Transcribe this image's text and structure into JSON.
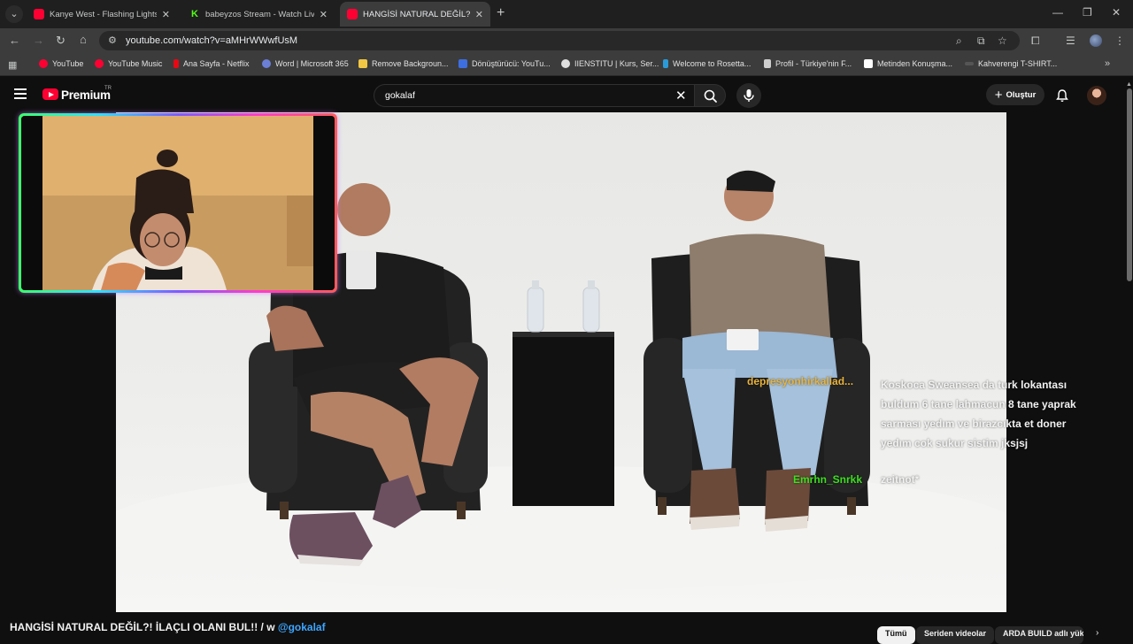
{
  "browser": {
    "tabs": [
      {
        "title": "Kanye West - Flashing Lights ft",
        "icon": "youtube-icon",
        "active": false
      },
      {
        "title": "babeyzos Stream - Watch Live",
        "icon": "kick-icon",
        "active": false
      },
      {
        "title": "HANGİSİ NATURAL DEĞİL?! İLAÇ",
        "icon": "youtube-icon",
        "active": true
      }
    ],
    "tab_close_glyph": "✕",
    "new_tab_glyph": "+",
    "tab_menu_glyph": "⌄",
    "kick_letter": "K",
    "window_controls": {
      "minimize": "—",
      "restore": "❐",
      "close": "✕"
    },
    "url": "youtube.com/watch?v=aMHrWWwfUsM",
    "bookmarks": [
      {
        "label": "YouTube",
        "color": "#ff0033"
      },
      {
        "label": "YouTube Music",
        "color": "#ff0033"
      },
      {
        "label": "Ana Sayfa - Netflix",
        "color": "#e50914"
      },
      {
        "label": "Word | Microsoft 365",
        "color": "#6b7fd6"
      },
      {
        "label": "Remove Backgroun...",
        "color": "#f2c744"
      },
      {
        "label": "Dönüştürücü: YouTu...",
        "color": "#3d6fe0"
      },
      {
        "label": "IIENSTITU | Kurs, Ser...",
        "color": "#e0e0e0"
      },
      {
        "label": "Welcome to Rosetta...",
        "color": "#2a9bd8"
      },
      {
        "label": "Profil - Türkiye'nin F...",
        "color": "#cfcfcf"
      },
      {
        "label": "Metinden Konuşma...",
        "color": "#ffffff"
      },
      {
        "label": "Kahverengi T-SHIRT...",
        "color": "#555555"
      }
    ]
  },
  "youtube": {
    "brand": "Premium",
    "region": "TR",
    "search_query": "gokalaf",
    "create_label": "Oluştur"
  },
  "chat": [
    {
      "user": "depresyonhirkaliad...",
      "message": "Koskoca Sweansea da turk lokantası buldum 6 tane lahmacun 8 tane yaprak sarması yedım ve birazcıkta et doner yedım cok sukur sistim jksjsj",
      "user_color": "#e8b33c"
    },
    {
      "user": "Emrhn_Snrkk",
      "message": "zeitnot*",
      "user_color": "#3ce01e"
    }
  ],
  "video": {
    "title_main": "HANGİSİ NATURAL DEĞİL?! İLAÇLI OLANI BUL!! / w",
    "title_mention": "@gokalaf"
  },
  "chips": [
    "Tümü",
    "Seriden videolar",
    "ARDA BUILD adlı yük"
  ],
  "chips_next": "›"
}
